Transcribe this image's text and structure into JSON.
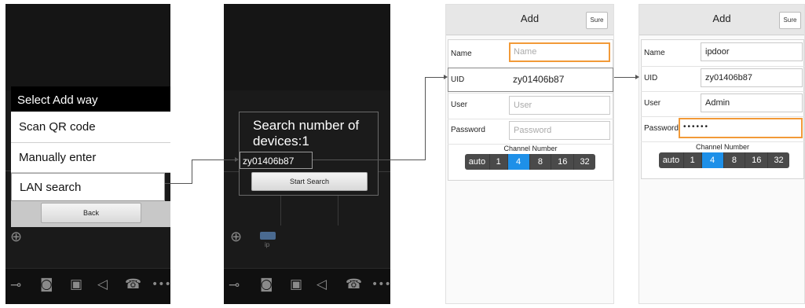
{
  "screen1": {
    "dialog_title": "Select Add way",
    "options": [
      "Scan QR code",
      "Manually enter",
      "LAN search"
    ],
    "back_label": "Back"
  },
  "screen2": {
    "search_text": "Search number of devices:1",
    "device_uid": "zy01406b87",
    "start_label": "Start Search",
    "camera_label": "ip"
  },
  "screen3": {
    "title": "Add",
    "sure_label": "Sure",
    "labels": {
      "name": "Name",
      "uid": "UID",
      "user": "User",
      "password": "Password"
    },
    "placeholders": {
      "name": "Name",
      "user": "User",
      "password": "Password"
    },
    "uid_value": "zy01406b87",
    "channel_title": "Channel Number",
    "channels": [
      "auto",
      "1",
      "4",
      "8",
      "16",
      "32"
    ],
    "selected_channel": "4"
  },
  "screen4": {
    "title": "Add",
    "sure_label": "Sure",
    "labels": {
      "name": "Name",
      "uid": "UID",
      "user": "User",
      "password": "Password"
    },
    "values": {
      "name": "ipdoor",
      "uid": "zy01406b87",
      "user": "Admin",
      "password": "••••••"
    },
    "channel_title": "Channel Number",
    "channels": [
      "auto",
      "1",
      "4",
      "8",
      "16",
      "32"
    ],
    "selected_channel": "4"
  },
  "colors": {
    "accent": "#1e90e8",
    "focus": "#f29a38",
    "dark_bg": "#1a1a1a"
  },
  "icons": [
    "plus-icon",
    "key-icon",
    "camera-icon",
    "video-icon",
    "speaker-icon",
    "phone-icon",
    "more-icon"
  ]
}
